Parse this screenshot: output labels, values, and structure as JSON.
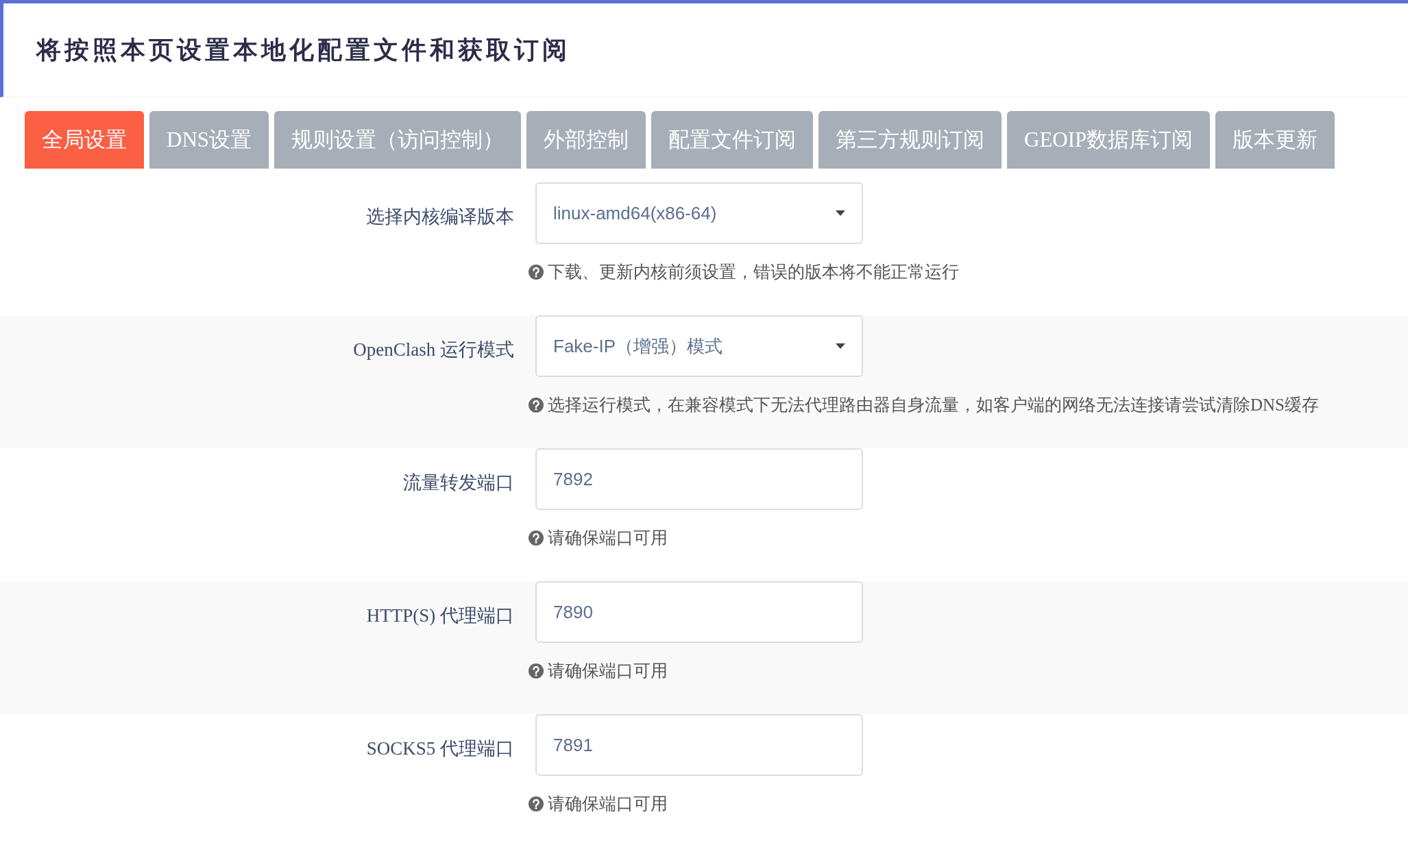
{
  "title": "将按照本页设置本地化配置文件和获取订阅",
  "tabs": [
    {
      "label": "全局设置",
      "selected": true
    },
    {
      "label": "DNS设置",
      "selected": false
    },
    {
      "label": "规则设置（访问控制）",
      "selected": false
    },
    {
      "label": "外部控制",
      "selected": false
    },
    {
      "label": "配置文件订阅",
      "selected": false
    },
    {
      "label": "第三方规则订阅",
      "selected": false
    },
    {
      "label": "GEOIP数据库订阅",
      "selected": false
    },
    {
      "label": "版本更新",
      "selected": false
    }
  ],
  "fields": [
    {
      "kind": "select",
      "label": "选择内核编译版本",
      "value": "linux-amd64(x86-64)",
      "hint": "下载、更新内核前须设置，错误的版本将不能正常运行"
    },
    {
      "kind": "select",
      "label": "OpenClash 运行模式",
      "value": "Fake-IP（增强）模式",
      "hint": "选择运行模式，在兼容模式下无法代理路由器自身流量，如客户端的网络无法连接请尝试清除DNS缓存"
    },
    {
      "kind": "text",
      "label": "流量转发端口",
      "value": "7892",
      "hint": "请确保端口可用"
    },
    {
      "kind": "text",
      "label": "HTTP(S) 代理端口",
      "value": "7890",
      "hint": "请确保端口可用"
    },
    {
      "kind": "text",
      "label": "SOCKS5 代理端口",
      "value": "7891",
      "hint": "请确保端口可用"
    }
  ]
}
